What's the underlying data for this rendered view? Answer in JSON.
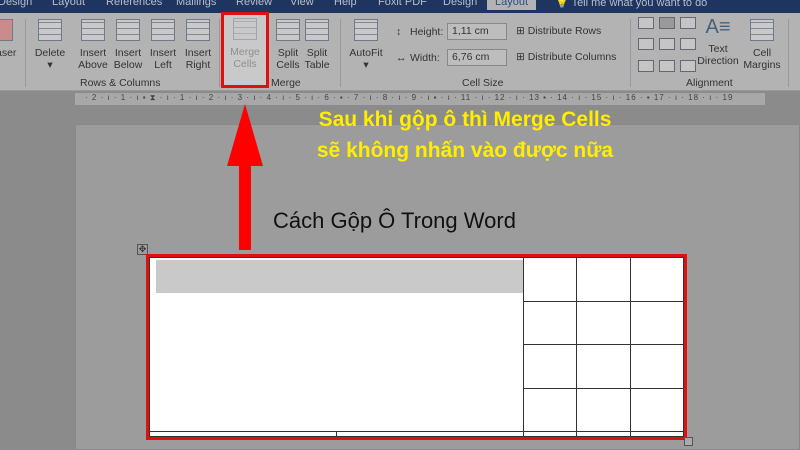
{
  "tabs": [
    "Design",
    "Layout",
    "References",
    "Mailings",
    "Review",
    "View",
    "Help",
    "Foxit PDF",
    "Design",
    "Layout",
    "Tell me what you want to do"
  ],
  "ribbon": {
    "eraser": "aser",
    "delete": "Delete",
    "insert_above": [
      "Insert",
      "Above"
    ],
    "insert_below": [
      "Insert",
      "Below"
    ],
    "insert_left": [
      "Insert",
      "Left"
    ],
    "insert_right": [
      "Insert",
      "Right"
    ],
    "rows_columns": "Rows & Columns",
    "merge_cells": [
      "Merge",
      "Cells"
    ],
    "split_cells": [
      "Split",
      "Cells"
    ],
    "split_table": [
      "Split",
      "Table"
    ],
    "merge_group": "Merge",
    "autofit": "AutoFit",
    "height_label": "Height:",
    "height_value": "1,11 cm",
    "width_label": "Width:",
    "width_value": "6,76 cm",
    "distribute_rows": "Distribute Rows",
    "distribute_columns": "Distribute Columns",
    "cell_size": "Cell Size",
    "text_direction": [
      "Text",
      "Direction"
    ],
    "cell_margins": [
      "Cell",
      "Margins"
    ],
    "alignment": "Alignment"
  },
  "ruler": "· 2 · ı · 1 · ı ▪ ⧗ · ı · 1 · ı · 2 · ı · 3 · ı · 4 · ı · 5 · ı · 6 · ▪ · 7 · ı · 8 · ı · 9 · ı ▪ · ı · 11 · ı · 12 · ı · 13 ▪ · 14 · ı · 15 · ı · 16 · ▪ 17 · ı · 18 · ı · 19",
  "annotation": [
    "Sau khi gộp ô thì Merge Cells",
    "sẽ không nhấn vào được nữa"
  ],
  "doc_title": "Cách Gộp Ô Trong Word"
}
